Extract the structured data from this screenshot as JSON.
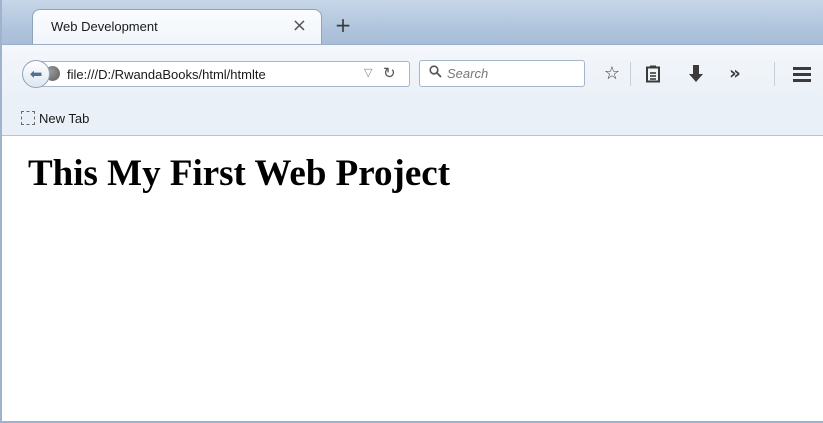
{
  "tab": {
    "title": "Web Development",
    "close": "×",
    "new_tab": "+"
  },
  "nav": {
    "url": "file:///D:/RwandaBooks/html/htmlte",
    "search_placeholder": "Search"
  },
  "icons": {
    "back": "back-arrow-icon",
    "site": "globe-icon",
    "dropmarker": "dropdown-triangle-icon",
    "reload": "reload-icon",
    "search": "magnifier-icon",
    "bookmark_star": "star-icon",
    "reader": "clipboard-icon",
    "download": "download-arrow-icon",
    "overflow": "chevron-double-right-icon",
    "menu": "hamburger-menu-icon"
  },
  "bookmarks": [
    {
      "label": "New Tab"
    }
  ],
  "page": {
    "heading": "This My First Web Project"
  }
}
